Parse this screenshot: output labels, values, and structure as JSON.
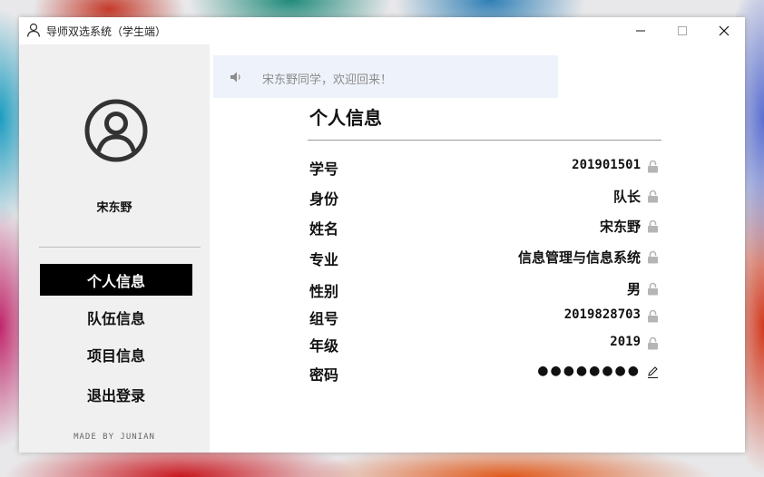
{
  "window": {
    "title": "导师双选系统（学生端）",
    "icons": {
      "title": "user-outline-icon",
      "minimize": "minimize-icon",
      "maximize": "maximize-icon",
      "close": "close-icon"
    }
  },
  "sidebar": {
    "avatar_icon": "user-circle-icon",
    "username": "宋东野",
    "items": [
      {
        "label": "个人信息",
        "active": true
      },
      {
        "label": "队伍信息",
        "active": false
      },
      {
        "label": "项目信息",
        "active": false
      },
      {
        "label": "退出登录",
        "active": false
      }
    ],
    "footer": "MADE BY JUNIAN"
  },
  "notice": {
    "icon": "speaker-icon",
    "text": "宋东野同学，欢迎回来！"
  },
  "main": {
    "title": "个人信息",
    "fields": [
      {
        "label": "学号",
        "value": "201901501",
        "icon": "lock-icon"
      },
      {
        "label": "身份",
        "value": "队长",
        "icon": "lock-icon"
      },
      {
        "label": "姓名",
        "value": "宋东野",
        "icon": "lock-icon"
      },
      {
        "label": "专业",
        "value": "信息管理与信息系统",
        "icon": "lock-icon"
      },
      {
        "label": "性别",
        "value": "男",
        "icon": "lock-icon"
      },
      {
        "label": "组号",
        "value": "2019828703",
        "icon": "lock-icon"
      },
      {
        "label": "年级",
        "value": "2019",
        "icon": "lock-icon"
      },
      {
        "label": "密码",
        "value": "●●●●●●●●",
        "icon": "edit-icon"
      }
    ]
  },
  "colors": {
    "active_nav_bg": "#000000",
    "sidebar_bg": "#f0f0f0",
    "notice_bg": "#eef2fa",
    "lock_icon": "#b5b5b5"
  }
}
